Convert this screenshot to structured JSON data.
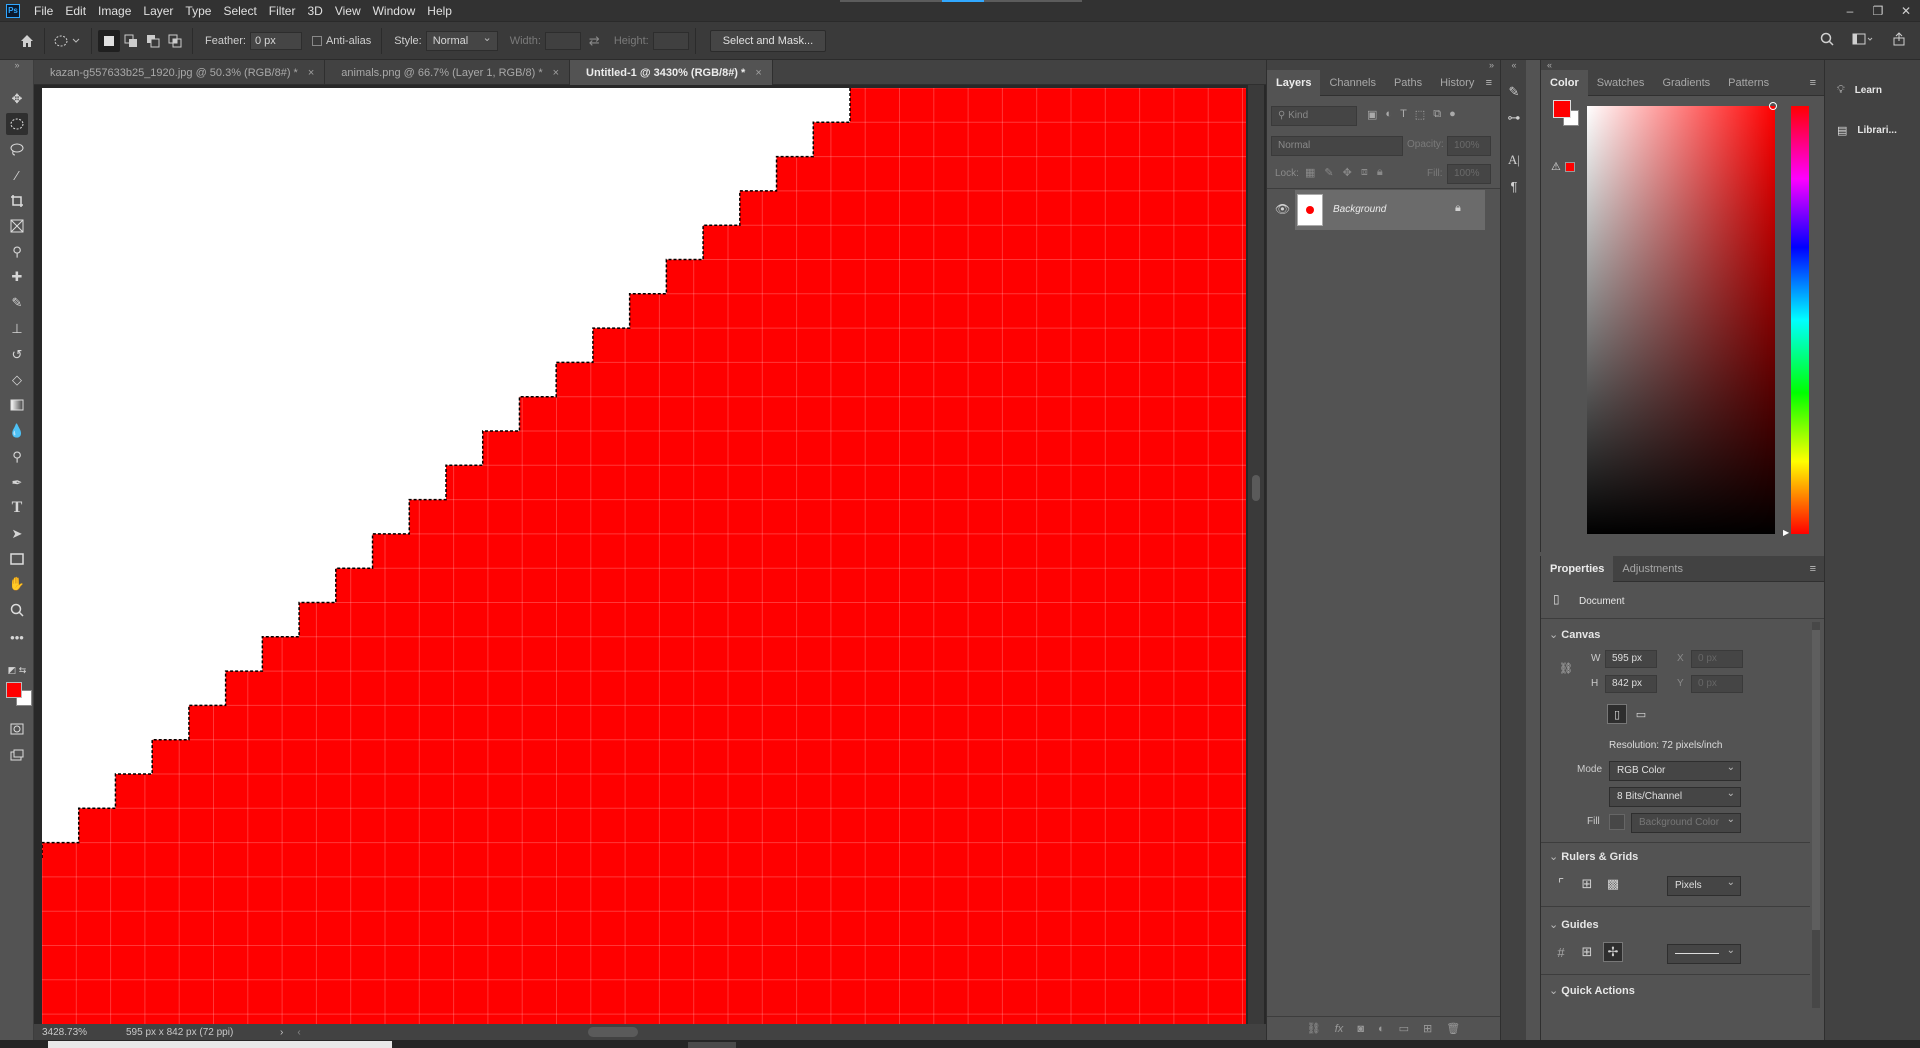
{
  "app": {
    "logo": "Ps"
  },
  "menu": [
    "File",
    "Edit",
    "Image",
    "Layer",
    "Type",
    "Select",
    "Filter",
    "3D",
    "View",
    "Window",
    "Help"
  ],
  "window_controls": {
    "minimize": "–",
    "restore": "❐",
    "close": "✕"
  },
  "options_bar": {
    "feather_label": "Feather:",
    "feather_value": "0 px",
    "antialias_label": "Anti-alias",
    "style_label": "Style:",
    "style_value": "Normal",
    "width_label": "Width:",
    "height_label": "Height:",
    "select_mask_label": "Select and Mask..."
  },
  "doc_tabs": [
    {
      "label": "kazan-g557633b25_1920.jpg @ 50.3% (RGB/8#) *",
      "close": "×",
      "active": false
    },
    {
      "label": "animals.png @ 66.7% (Layer 1, RGB/8) *",
      "close": "×",
      "active": false
    },
    {
      "label": "Untitled-1 @ 3430% (RGB/8#) *",
      "close": "×",
      "active": true
    }
  ],
  "status": {
    "zoom": "3428.73%",
    "doc_size": "595 px x 842 px (72 ppi)",
    "arrow": "›"
  },
  "colors": {
    "foreground": "#ff0000",
    "background": "#ffffff",
    "canvas_fill": "#ff0000"
  },
  "layers_panel": {
    "tabs": [
      "Layers",
      "Channels",
      "Paths",
      "History"
    ],
    "kind_placeholder": "Kind",
    "blend_mode": "Normal",
    "opacity_label": "Opacity:",
    "opacity_value": "100%",
    "lock_label": "Lock:",
    "fill_label": "Fill:",
    "fill_value": "100%",
    "layers": [
      {
        "name": "Background",
        "locked": true,
        "visible": true
      }
    ]
  },
  "color_panel": {
    "tabs": [
      "Color",
      "Swatches",
      "Gradients",
      "Patterns"
    ]
  },
  "learn_panel": {
    "learn_label": "Learn",
    "libraries_label": "Librari..."
  },
  "properties_panel": {
    "tabs": [
      "Properties",
      "Adjustments"
    ],
    "doc_label": "Document",
    "canvas_label": "Canvas",
    "w_label": "W",
    "w_value": "595 px",
    "h_label": "H",
    "h_value": "842 px",
    "x_label": "X",
    "x_value": "0 px",
    "y_label": "Y",
    "y_value": "0 px",
    "resolution": "Resolution: 72 pixels/inch",
    "mode_label": "Mode",
    "mode_value": "RGB Color",
    "bits_value": "8 Bits/Channel",
    "fill_label": "Fill",
    "fill_value": "Background Color",
    "rulers_label": "Rulers & Grids",
    "units_value": "Pixels",
    "guides_label": "Guides",
    "quick_actions_label": "Quick Actions"
  }
}
